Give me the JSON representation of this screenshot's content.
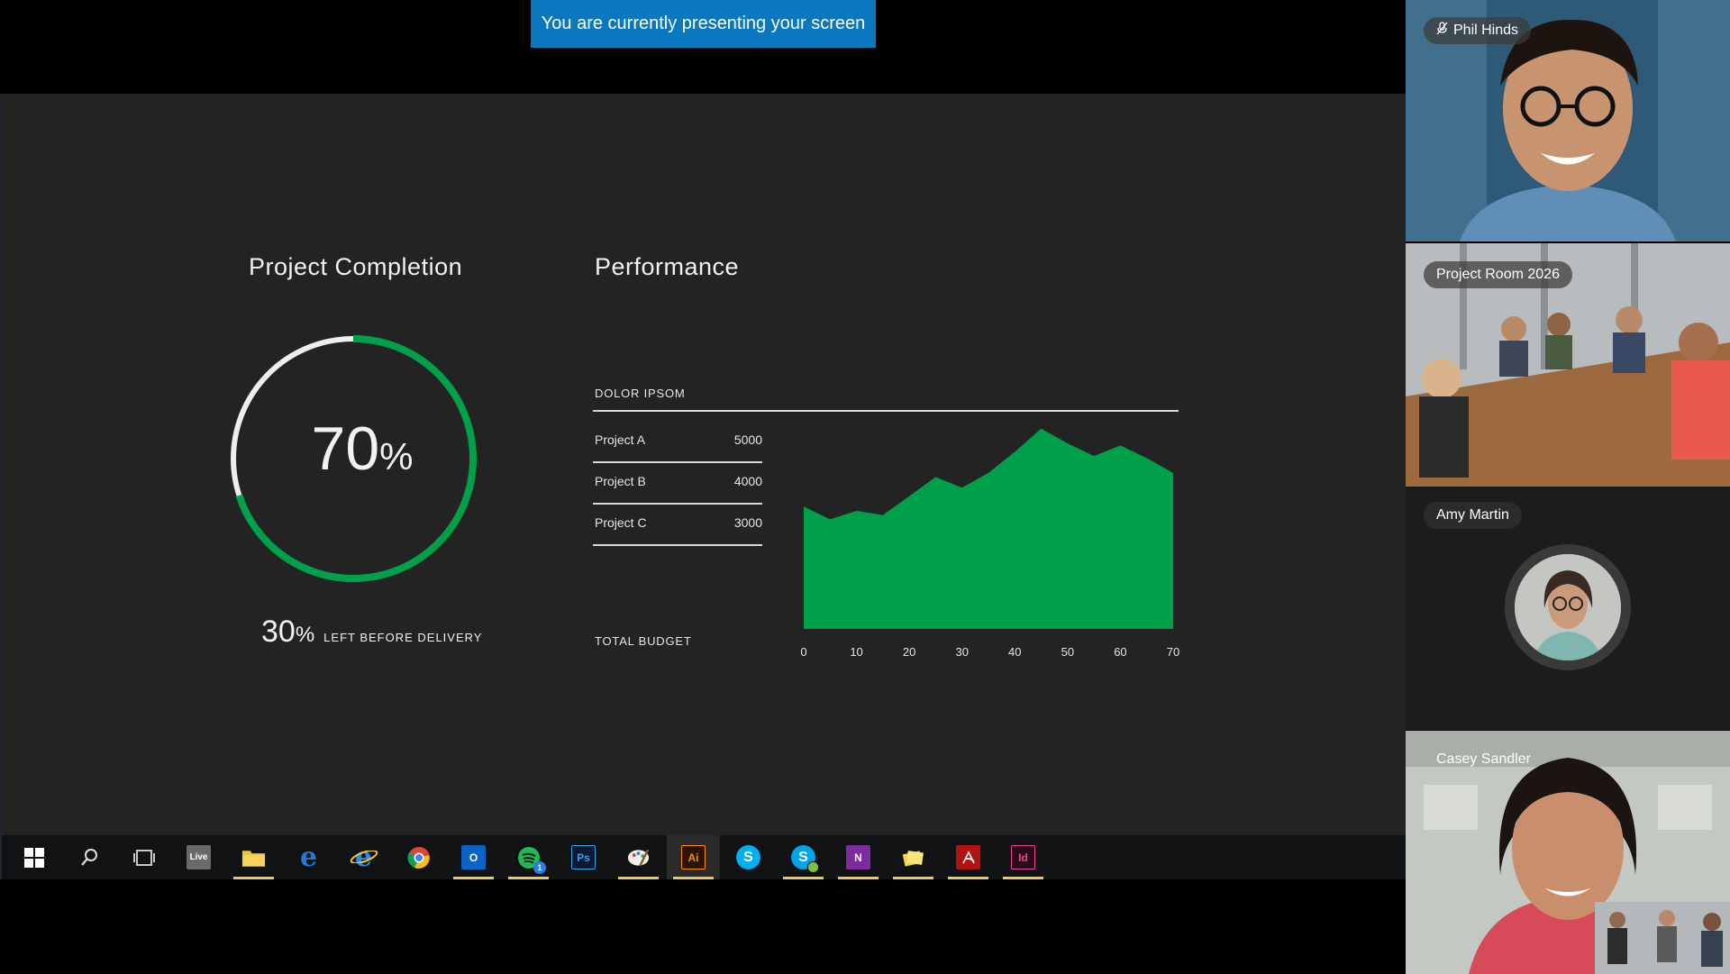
{
  "banner": {
    "text": "You are currently presenting your screen"
  },
  "dashboard": {
    "completion": {
      "title": "Project Completion",
      "value": "70",
      "unit": "%",
      "remaining_value": "30",
      "remaining_unit": "%",
      "remaining_label": "LEFT BEFORE DELIVERY",
      "progress": 0.7
    },
    "performance": {
      "title": "Performance",
      "section_label": "DOLOR IPSOM",
      "projects": [
        {
          "name": "Project A",
          "value": "5000"
        },
        {
          "name": "Project B",
          "value": "4000"
        },
        {
          "name": "Project C",
          "value": "3000"
        }
      ],
      "total_label": "TOTAL BUDGET"
    }
  },
  "chart_data": {
    "type": "area",
    "x": [
      0,
      5,
      10,
      15,
      20,
      25,
      30,
      35,
      40,
      45,
      50,
      55,
      60,
      65,
      70
    ],
    "y": [
      58,
      52,
      56,
      54,
      63,
      72,
      67,
      74,
      84,
      95,
      88,
      82,
      87,
      81,
      74
    ],
    "xticks": [
      "0",
      "10",
      "20",
      "30",
      "40",
      "50",
      "60",
      "70"
    ],
    "xlim": [
      0,
      70
    ],
    "ylim": [
      0,
      100
    ],
    "color": "#00a04a"
  },
  "taskbar": {
    "items": [
      {
        "name": "start",
        "icon": "windows-icon",
        "label": "",
        "active": false,
        "running": false
      },
      {
        "name": "search",
        "icon": "search-icon",
        "label": "",
        "active": false,
        "running": false
      },
      {
        "name": "task-view",
        "icon": "task-view-icon",
        "label": "",
        "active": false,
        "running": false
      },
      {
        "name": "live",
        "icon": "live-icon",
        "label": "Live",
        "active": false,
        "running": false
      },
      {
        "name": "file-explorer",
        "icon": "folder-icon",
        "label": "",
        "active": false,
        "running": true
      },
      {
        "name": "edge",
        "icon": "edge-icon",
        "label": "e",
        "active": false,
        "running": false
      },
      {
        "name": "internet-explorer",
        "icon": "ie-icon",
        "label": "e",
        "active": false,
        "running": false
      },
      {
        "name": "chrome",
        "icon": "chrome-icon",
        "label": "",
        "active": false,
        "running": false
      },
      {
        "name": "outlook",
        "icon": "outlook-icon",
        "label": "O",
        "active": false,
        "running": true
      },
      {
        "name": "spotify",
        "icon": "spotify-icon",
        "label": "",
        "badge": "1",
        "active": false,
        "running": true
      },
      {
        "name": "photoshop",
        "icon": "photoshop-icon",
        "label": "Ps",
        "active": false,
        "running": false
      },
      {
        "name": "paint",
        "icon": "paint-icon",
        "label": "",
        "active": false,
        "running": true
      },
      {
        "name": "illustrator",
        "icon": "illustrator-icon",
        "label": "Ai",
        "active": true,
        "running": true
      },
      {
        "name": "skype",
        "icon": "skype-icon",
        "label": "S",
        "active": false,
        "running": false
      },
      {
        "name": "skype-business",
        "icon": "skype-business-icon",
        "label": "S",
        "active": false,
        "running": true
      },
      {
        "name": "onenote",
        "icon": "onenote-icon",
        "label": "N",
        "active": false,
        "running": true
      },
      {
        "name": "sticky-notes",
        "icon": "sticky-notes-icon",
        "label": "",
        "active": false,
        "running": true
      },
      {
        "name": "acrobat",
        "icon": "acrobat-icon",
        "label": "",
        "active": false,
        "running": true
      },
      {
        "name": "indesign",
        "icon": "indesign-icon",
        "label": "Id",
        "active": false,
        "running": true
      }
    ]
  },
  "participants": [
    {
      "name": "Phil Hinds",
      "muted": true,
      "icon": "mic-off-icon"
    },
    {
      "name": "Project Room 2026"
    },
    {
      "name": "Amy Martin"
    },
    {
      "name": "Casey Sandler"
    }
  ],
  "colors": {
    "accent": "#00a04a",
    "banner": "#0a78be",
    "ring_track": "#eeeeee"
  }
}
